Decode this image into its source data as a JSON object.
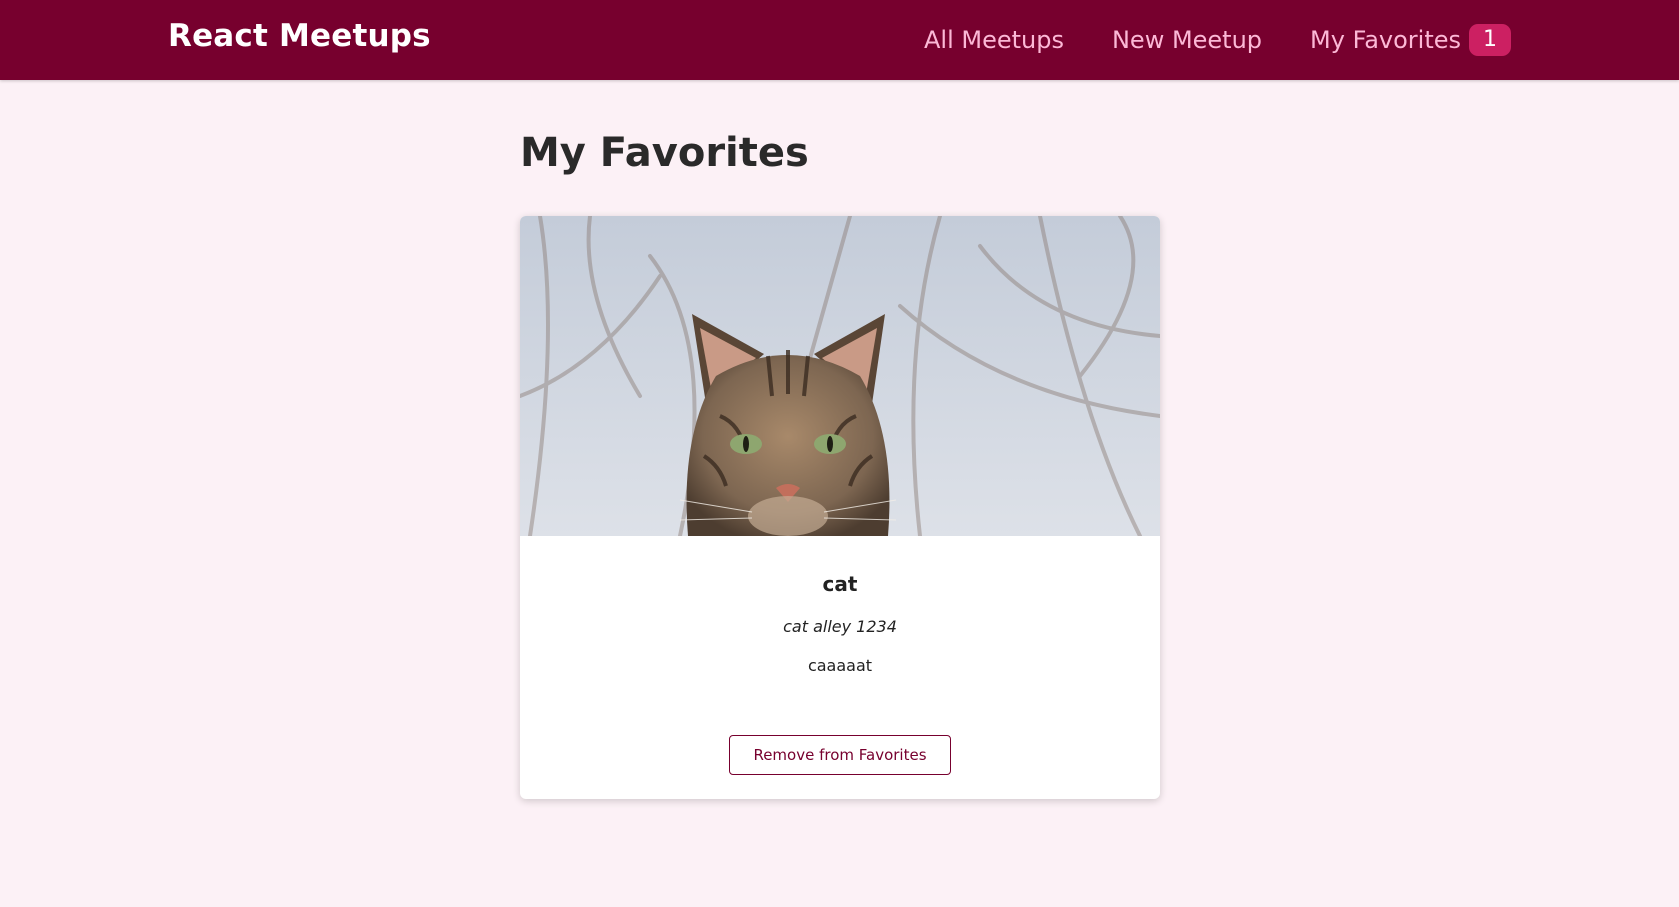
{
  "header": {
    "logo": "React Meetups",
    "nav": {
      "all_meetups": "All Meetups",
      "new_meetup": "New Meetup",
      "my_favorites": "My Favorites",
      "favorites_count": "1"
    }
  },
  "main": {
    "title": "My Favorites",
    "meetups": [
      {
        "title": "cat",
        "address": "cat alley 1234",
        "description": "caaaaat",
        "image_subject": "tabby-cat-photo",
        "action_label": "Remove from Favorites"
      }
    ]
  },
  "colors": {
    "header_bg": "#77002e",
    "page_bg": "#fcf1f6",
    "nav_link": "#fcb8d6",
    "badge_bg": "#cc2062",
    "button_border": "#77002e"
  }
}
